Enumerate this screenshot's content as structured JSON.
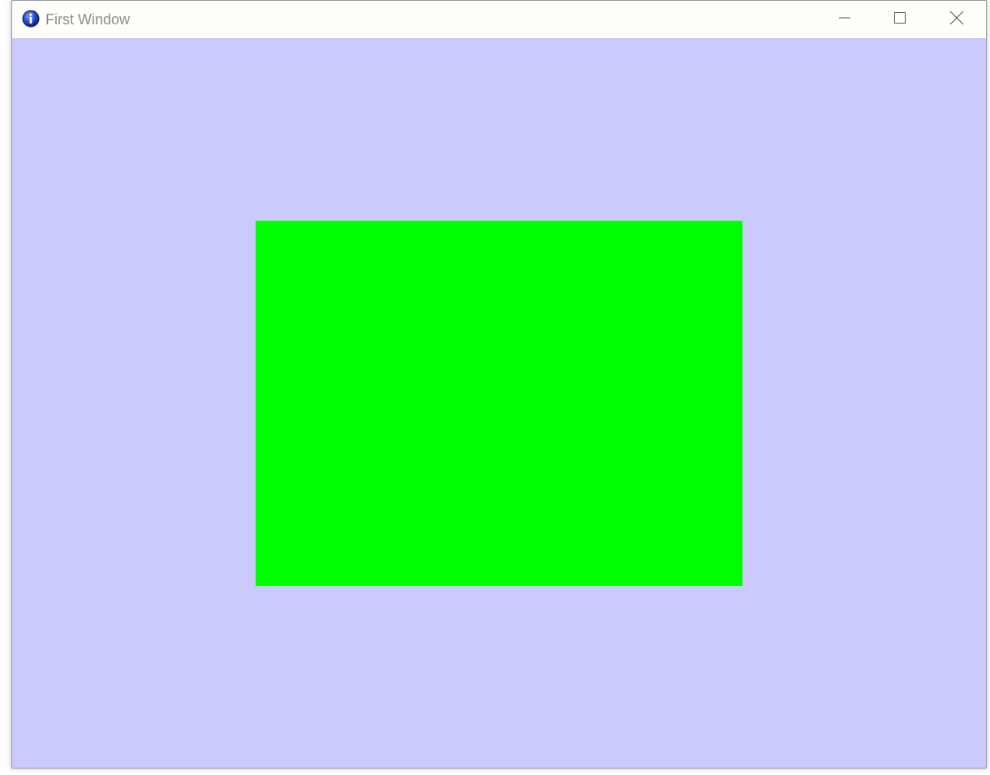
{
  "window": {
    "title": "First Window",
    "app_icon": "info-icon",
    "client_background": "#cacafd",
    "titlebar_background": "#fefefa"
  },
  "caption_buttons": {
    "minimize_icon": "minimize-icon",
    "maximize_icon": "maximize-icon",
    "close_icon": "close-icon"
  },
  "canvas": {
    "shape": "rectangle",
    "fill_color": "#00ff00"
  }
}
